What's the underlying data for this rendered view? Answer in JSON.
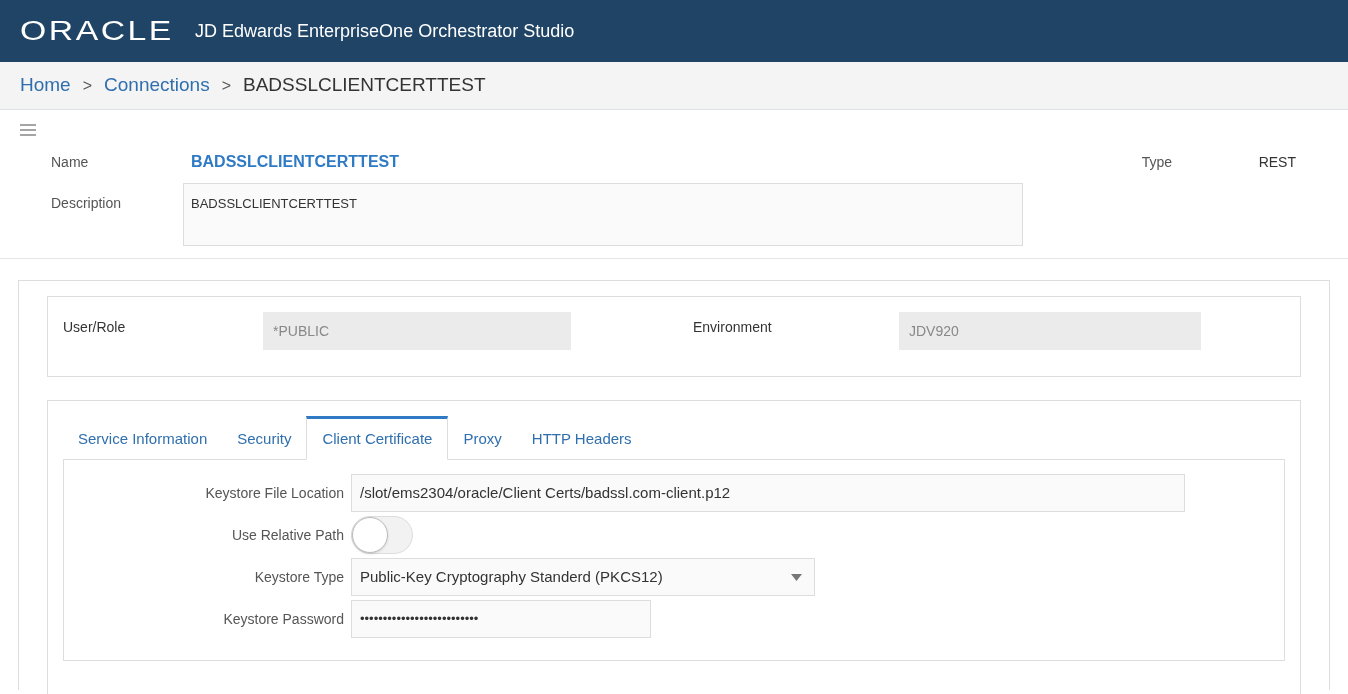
{
  "header": {
    "logo": "ORACLE",
    "title": "JD Edwards EnterpriseOne Orchestrator Studio"
  },
  "breadcrumb": [
    {
      "label": "Home",
      "link": true
    },
    {
      "label": "Connections",
      "link": true
    },
    {
      "label": "BADSSLCLIENTCERTTEST",
      "link": false
    }
  ],
  "breadcrumb_separator": ">",
  "connection": {
    "name_label": "Name",
    "name": "BADSSLCLIENTCERTTEST",
    "type_label": "Type",
    "type": "REST",
    "description_label": "Description",
    "description": "BADSSLCLIENTCERTTEST"
  },
  "context": {
    "user_label": "User/Role",
    "user": "*PUBLIC",
    "environment_label": "Environment",
    "environment": "JDV920"
  },
  "tabs": [
    {
      "label": "Service Information",
      "selected": false
    },
    {
      "label": "Security",
      "selected": false
    },
    {
      "label": "Client Certificate",
      "selected": true
    },
    {
      "label": "Proxy",
      "selected": false
    },
    {
      "label": "HTTP Headers",
      "selected": false
    }
  ],
  "form": [
    {
      "kind": "text",
      "label": "Keystore File Location",
      "value": "/slot/ems2304/oracle/Client Certs/badssl.com-client.p12"
    },
    {
      "kind": "toggle",
      "label": "Use Relative Path",
      "on": false
    },
    {
      "kind": "select",
      "label": "Keystore Type",
      "value": "Public-Key Cryptography Standerd (PKCS12)"
    },
    {
      "kind": "password",
      "label": "Keystore Password",
      "value": "••••••••••••••••••••••••••"
    }
  ]
}
